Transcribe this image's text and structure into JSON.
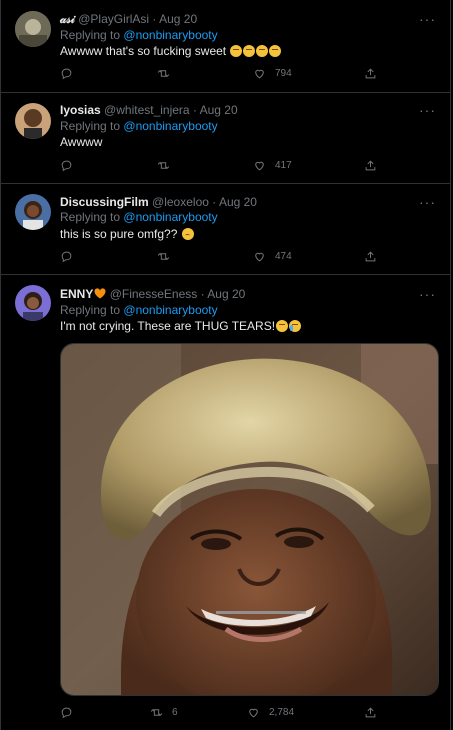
{
  "tweets": [
    {
      "name": "𝒶𝓈𝒾",
      "handle": "@PlayGirlAsi",
      "dot": "·",
      "date": "Aug 20",
      "reply_prefix": "Replying to",
      "reply_to": "@nonbinarybooty",
      "text": "Awwww that's so fucking sweet",
      "emojis": [
        "smiling-face-icon",
        "smiling-face-icon",
        "smiling-face-icon",
        "smiling-face-icon"
      ],
      "reply_count": "",
      "retweet_count": "",
      "like_count": "794"
    },
    {
      "name": "Iyosias",
      "handle": "@whitest_injera",
      "dot": "·",
      "date": "Aug 20",
      "reply_prefix": "Replying to",
      "reply_to": "@nonbinarybooty",
      "text": "Awwww",
      "emojis": [],
      "reply_count": "",
      "retweet_count": "",
      "like_count": "417"
    },
    {
      "name": "DiscussingFilm",
      "handle": "@leoxeloo",
      "dot": "·",
      "date": "Aug 20",
      "reply_prefix": "Replying to",
      "reply_to": "@nonbinarybooty",
      "text": "this is so pure omfg??",
      "emojis": [
        "pleading-face-icon"
      ],
      "reply_count": "",
      "retweet_count": "",
      "like_count": "474"
    },
    {
      "name": "ENNY",
      "name_emoji": "orange-heart-icon",
      "handle": "@FinesseEness",
      "dot": "·",
      "date": "Aug 20",
      "reply_prefix": "Replying to",
      "reply_to": "@nonbinarybooty",
      "text": "I'm not crying. These are THUG TEARS!",
      "emojis": [
        "smiling-face-icon",
        "crying-face-icon"
      ],
      "reply_count": "",
      "retweet_count": "6",
      "like_count": "2,784",
      "media": "crying-person-photo"
    }
  ],
  "more_label": "···",
  "colors": {
    "background": "#000000",
    "text": "#e7e9ea",
    "muted": "#71767b",
    "link": "#1d9bf0",
    "border": "#2f3336"
  }
}
